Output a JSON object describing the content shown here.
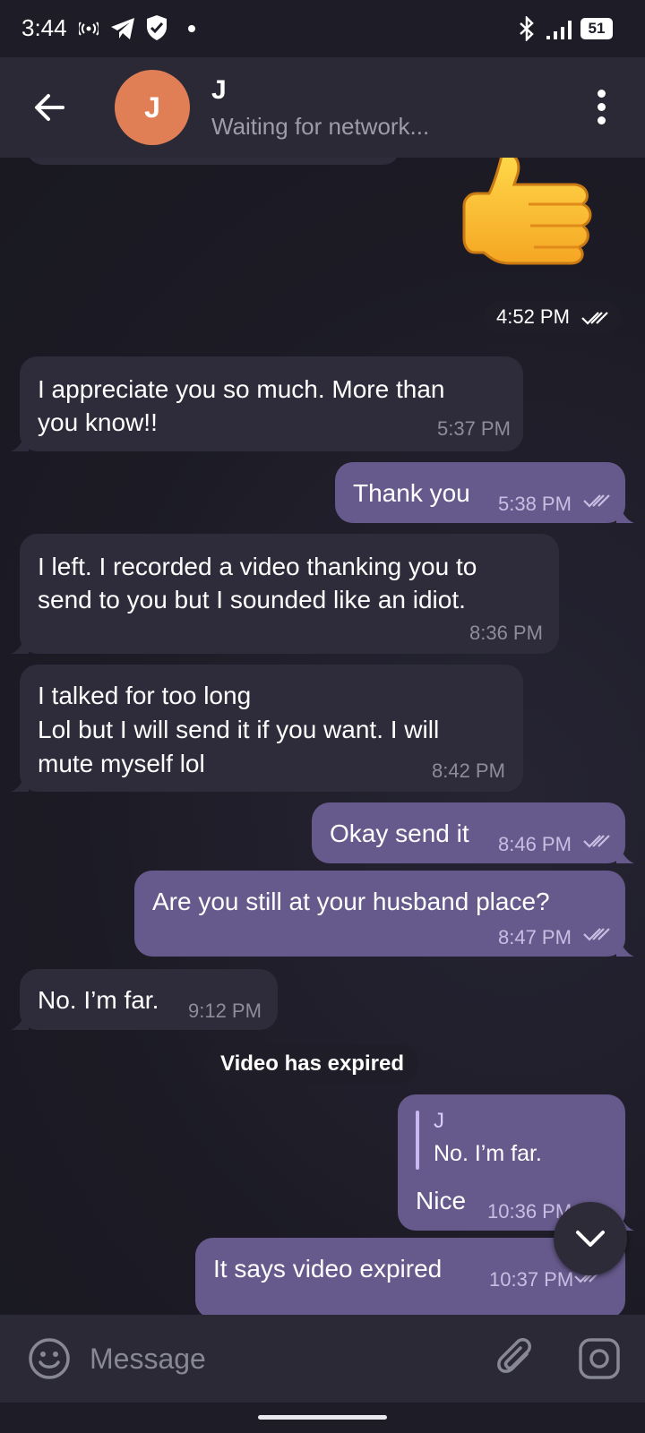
{
  "status_bar": {
    "time": "3:44",
    "battery": "51",
    "icons": [
      "hotspot-icon",
      "telegram-icon",
      "shield-icon",
      "dot-icon",
      "bluetooth-icon",
      "signal-icon",
      "battery-icon"
    ]
  },
  "header": {
    "avatar_letter": "J",
    "contact_name": "J",
    "status": "Waiting for network...",
    "avatar_color": "#e07f56"
  },
  "chat": {
    "sticker_time": "4:52 PM",
    "messages": [
      {
        "direction": "in",
        "text": [
          "I appreciate you so much. More than",
          "you know!!"
        ],
        "time": "5:37 PM"
      },
      {
        "direction": "out",
        "text": [
          "Thank you"
        ],
        "time": "5:38 PM"
      },
      {
        "direction": "in",
        "text": [
          "I left. I recorded a video thanking you to",
          "send to you but I sounded like an idiot."
        ],
        "time": "8:36 PM"
      },
      {
        "direction": "in",
        "text": [
          "I talked for too long",
          "Lol but I will send it if you want. I will",
          "mute myself lol"
        ],
        "time": "8:42 PM"
      },
      {
        "direction": "out",
        "text": [
          "Okay send it"
        ],
        "time": "8:46 PM"
      },
      {
        "direction": "out",
        "text": [
          "Are you still at your  husband place?"
        ],
        "time": "8:47 PM"
      },
      {
        "direction": "in",
        "text": [
          "No. I’m far."
        ],
        "time": "9:12 PM"
      },
      {
        "direction": "out",
        "reply_to": {
          "name": "J",
          "text": "No. I’m far."
        },
        "text": [
          "Nice"
        ],
        "time": "10:36 PM"
      },
      {
        "direction": "out",
        "text": [
          "It says video expired"
        ],
        "time": "10:37 PM"
      }
    ],
    "service_message": "Video has expired"
  },
  "composer": {
    "placeholder": "Message"
  },
  "colors": {
    "incoming_bubble": "#2e2c3a",
    "outgoing_bubble": "#665a8c",
    "header": "#2a2935"
  }
}
